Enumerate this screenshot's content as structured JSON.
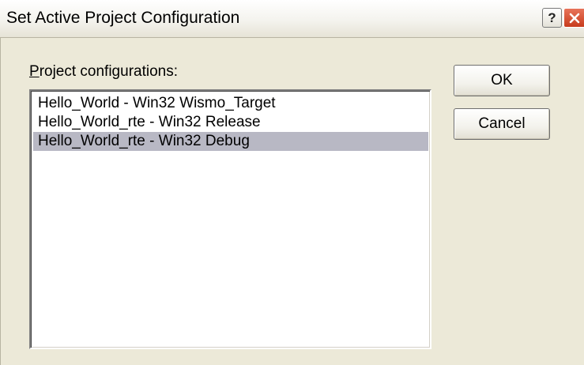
{
  "window": {
    "title": "Set Active Project Configuration",
    "help_label": "?"
  },
  "configurations": {
    "label_accesskey": "P",
    "label_rest": "roject configurations:",
    "items": [
      {
        "label": "Hello_World - Win32 Wismo_Target",
        "selected": false
      },
      {
        "label": "Hello_World_rte - Win32 Release",
        "selected": false
      },
      {
        "label": "Hello_World_rte - Win32 Debug",
        "selected": true
      }
    ]
  },
  "buttons": {
    "ok_label": "OK",
    "cancel_label": "Cancel"
  },
  "colors": {
    "selection": "#b8b8c4",
    "close_button": "#c73b1c",
    "dialog_background": "#ece9d8"
  },
  "icons": {
    "help": "help-icon",
    "close": "close-icon"
  }
}
